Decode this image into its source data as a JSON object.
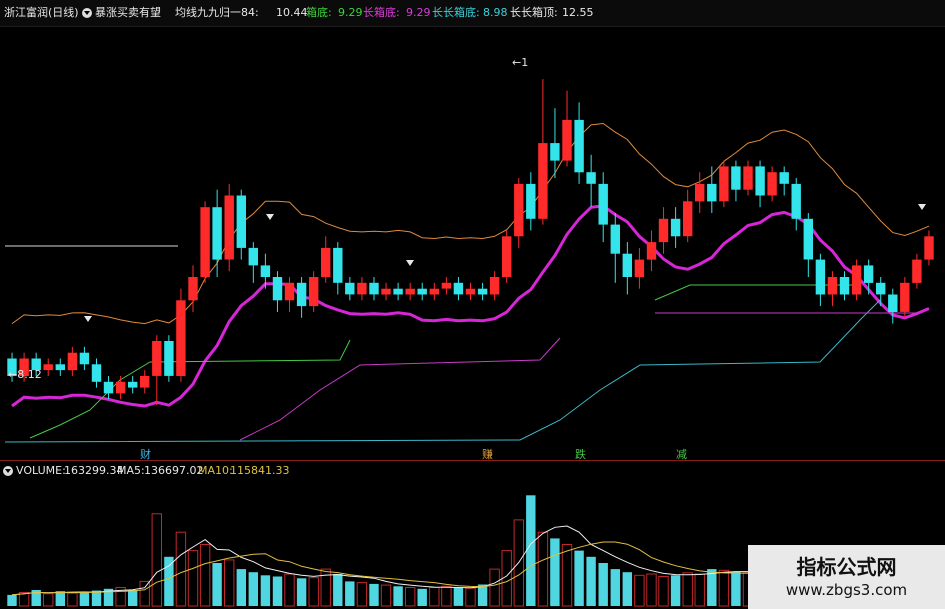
{
  "header": {
    "stock_name": "浙江富润(日线)",
    "indicator_name": "暴涨买卖有望",
    "ma_label": "均线九九归一84:",
    "ma_value": "10.44",
    "box_bottom_label": "箱底:",
    "box_bottom_value": "9.29",
    "long_box_bottom_label": "长箱底:",
    "long_box_bottom_value": "9.29",
    "longlong_box_bottom_label": "长长箱底:",
    "longlong_box_bottom_value": "8.98",
    "longlong_box_top_label": "长长箱顶:",
    "longlong_box_top_value": "12.55"
  },
  "chart_markers": {
    "high_price_label": "←1",
    "low_price_label": "←8.12",
    "signals": [
      "财",
      "赚",
      "跌",
      "减"
    ]
  },
  "volume": {
    "label": "VOLUME:",
    "value": "163299.34",
    "ma5_label": "MA5:",
    "ma5_value": "136697.02",
    "ma10_label": "MA10:",
    "ma10_value": "115841.33"
  },
  "watermark": {
    "title": "指标公式网",
    "url": "www.zbgs3.com"
  },
  "colors": {
    "up": "#ff2a2a",
    "down": "#33e4ea",
    "ma84": "#d726d7",
    "box_line": "#e08a3a",
    "volume_up": "#c0282a",
    "volume_down": "#4fd6e0",
    "ma5_line": "#f0f0f0",
    "ma10_line": "#e0c040"
  },
  "chart_data": {
    "type": "candlestick",
    "price_axis": {
      "min": 7.5,
      "max": 14.2
    },
    "candles": [
      {
        "o": 8.9,
        "c": 8.6,
        "h": 9.0,
        "l": 8.5
      },
      {
        "o": 8.6,
        "c": 8.9,
        "h": 9.0,
        "l": 8.5
      },
      {
        "o": 8.9,
        "c": 8.7,
        "h": 9.0,
        "l": 8.6
      },
      {
        "o": 8.7,
        "c": 8.8,
        "h": 8.9,
        "l": 8.6
      },
      {
        "o": 8.8,
        "c": 8.7,
        "h": 8.9,
        "l": 8.6
      },
      {
        "o": 8.7,
        "c": 9.0,
        "h": 9.1,
        "l": 8.6
      },
      {
        "o": 9.0,
        "c": 8.8,
        "h": 9.1,
        "l": 8.7
      },
      {
        "o": 8.8,
        "c": 8.5,
        "h": 8.9,
        "l": 8.4
      },
      {
        "o": 8.5,
        "c": 8.3,
        "h": 8.6,
        "l": 8.2
      },
      {
        "o": 8.3,
        "c": 8.5,
        "h": 8.6,
        "l": 8.2
      },
      {
        "o": 8.5,
        "c": 8.4,
        "h": 8.6,
        "l": 8.3
      },
      {
        "o": 8.4,
        "c": 8.6,
        "h": 8.7,
        "l": 8.3
      },
      {
        "o": 8.6,
        "c": 9.2,
        "h": 9.3,
        "l": 8.1
      },
      {
        "o": 9.2,
        "c": 8.6,
        "h": 9.3,
        "l": 8.5
      },
      {
        "o": 8.6,
        "c": 9.9,
        "h": 10.1,
        "l": 8.5
      },
      {
        "o": 9.9,
        "c": 10.3,
        "h": 10.5,
        "l": 9.7
      },
      {
        "o": 10.3,
        "c": 11.5,
        "h": 11.6,
        "l": 10.2
      },
      {
        "o": 11.5,
        "c": 10.6,
        "h": 11.8,
        "l": 10.3
      },
      {
        "o": 10.6,
        "c": 11.7,
        "h": 11.9,
        "l": 10.4
      },
      {
        "o": 11.7,
        "c": 10.8,
        "h": 11.8,
        "l": 10.6
      },
      {
        "o": 10.8,
        "c": 10.5,
        "h": 10.9,
        "l": 10.2
      },
      {
        "o": 10.5,
        "c": 10.3,
        "h": 10.7,
        "l": 10.1
      },
      {
        "o": 10.3,
        "c": 9.9,
        "h": 10.4,
        "l": 9.7
      },
      {
        "o": 9.9,
        "c": 10.2,
        "h": 10.3,
        "l": 9.7
      },
      {
        "o": 10.2,
        "c": 9.8,
        "h": 10.3,
        "l": 9.6
      },
      {
        "o": 9.8,
        "c": 10.3,
        "h": 10.4,
        "l": 9.7
      },
      {
        "o": 10.3,
        "c": 10.8,
        "h": 11.0,
        "l": 10.2
      },
      {
        "o": 10.8,
        "c": 10.2,
        "h": 10.9,
        "l": 10.0
      },
      {
        "o": 10.2,
        "c": 10.0,
        "h": 10.3,
        "l": 9.9
      },
      {
        "o": 10.0,
        "c": 10.2,
        "h": 10.3,
        "l": 9.9
      },
      {
        "o": 10.2,
        "c": 10.0,
        "h": 10.3,
        "l": 9.9
      },
      {
        "o": 10.0,
        "c": 10.1,
        "h": 10.2,
        "l": 9.9
      },
      {
        "o": 10.1,
        "c": 10.0,
        "h": 10.2,
        "l": 9.9
      },
      {
        "o": 10.0,
        "c": 10.1,
        "h": 10.2,
        "l": 9.9
      },
      {
        "o": 10.1,
        "c": 10.0,
        "h": 10.2,
        "l": 9.9
      },
      {
        "o": 10.0,
        "c": 10.1,
        "h": 10.2,
        "l": 9.9
      },
      {
        "o": 10.1,
        "c": 10.2,
        "h": 10.3,
        "l": 10.0
      },
      {
        "o": 10.2,
        "c": 10.0,
        "h": 10.3,
        "l": 9.9
      },
      {
        "o": 10.0,
        "c": 10.1,
        "h": 10.2,
        "l": 9.9
      },
      {
        "o": 10.1,
        "c": 10.0,
        "h": 10.2,
        "l": 9.9
      },
      {
        "o": 10.0,
        "c": 10.3,
        "h": 10.4,
        "l": 9.9
      },
      {
        "o": 10.3,
        "c": 11.0,
        "h": 11.1,
        "l": 10.2
      },
      {
        "o": 11.0,
        "c": 11.9,
        "h": 12.0,
        "l": 10.8
      },
      {
        "o": 11.9,
        "c": 11.3,
        "h": 12.1,
        "l": 11.1
      },
      {
        "o": 11.3,
        "c": 12.6,
        "h": 13.7,
        "l": 11.2
      },
      {
        "o": 12.6,
        "c": 12.3,
        "h": 13.2,
        "l": 12.0
      },
      {
        "o": 12.3,
        "c": 13.0,
        "h": 13.5,
        "l": 12.2
      },
      {
        "o": 13.0,
        "c": 12.1,
        "h": 13.3,
        "l": 11.9
      },
      {
        "o": 12.1,
        "c": 11.9,
        "h": 12.4,
        "l": 11.5
      },
      {
        "o": 11.9,
        "c": 11.2,
        "h": 12.1,
        "l": 10.9
      },
      {
        "o": 11.2,
        "c": 10.7,
        "h": 11.4,
        "l": 10.2
      },
      {
        "o": 10.7,
        "c": 10.3,
        "h": 10.9,
        "l": 10.0
      },
      {
        "o": 10.3,
        "c": 10.6,
        "h": 10.8,
        "l": 10.1
      },
      {
        "o": 10.6,
        "c": 10.9,
        "h": 11.1,
        "l": 10.4
      },
      {
        "o": 10.9,
        "c": 11.3,
        "h": 11.5,
        "l": 10.7
      },
      {
        "o": 11.3,
        "c": 11.0,
        "h": 11.5,
        "l": 10.8
      },
      {
        "o": 11.0,
        "c": 11.6,
        "h": 11.8,
        "l": 10.9
      },
      {
        "o": 11.6,
        "c": 11.9,
        "h": 12.1,
        "l": 11.4
      },
      {
        "o": 11.9,
        "c": 11.6,
        "h": 12.2,
        "l": 11.4
      },
      {
        "o": 11.6,
        "c": 12.2,
        "h": 12.3,
        "l": 11.5
      },
      {
        "o": 12.2,
        "c": 11.8,
        "h": 12.3,
        "l": 11.6
      },
      {
        "o": 11.8,
        "c": 12.2,
        "h": 12.3,
        "l": 11.7
      },
      {
        "o": 12.2,
        "c": 11.7,
        "h": 12.3,
        "l": 11.5
      },
      {
        "o": 11.7,
        "c": 12.1,
        "h": 12.2,
        "l": 11.6
      },
      {
        "o": 12.1,
        "c": 11.9,
        "h": 12.2,
        "l": 11.7
      },
      {
        "o": 11.9,
        "c": 11.3,
        "h": 12.0,
        "l": 11.1
      },
      {
        "o": 11.3,
        "c": 10.6,
        "h": 11.4,
        "l": 10.3
      },
      {
        "o": 10.6,
        "c": 10.0,
        "h": 10.7,
        "l": 9.8
      },
      {
        "o": 10.0,
        "c": 10.3,
        "h": 10.4,
        "l": 9.8
      },
      {
        "o": 10.3,
        "c": 10.0,
        "h": 10.4,
        "l": 9.9
      },
      {
        "o": 10.0,
        "c": 10.5,
        "h": 10.6,
        "l": 9.9
      },
      {
        "o": 10.5,
        "c": 10.2,
        "h": 10.6,
        "l": 10.0
      },
      {
        "o": 10.2,
        "c": 10.0,
        "h": 10.3,
        "l": 9.8
      },
      {
        "o": 10.0,
        "c": 9.7,
        "h": 10.1,
        "l": 9.5
      },
      {
        "o": 9.7,
        "c": 10.2,
        "h": 10.3,
        "l": 9.6
      },
      {
        "o": 10.2,
        "c": 10.6,
        "h": 10.7,
        "l": 10.1
      },
      {
        "o": 10.6,
        "c": 11.0,
        "h": 11.1,
        "l": 10.5
      }
    ],
    "volume_axis": {
      "min": 0,
      "max": 200000
    },
    "volume": [
      18000,
      22000,
      26000,
      20000,
      24000,
      21000,
      23000,
      25000,
      28000,
      30000,
      26000,
      40000,
      150000,
      80000,
      120000,
      90000,
      100000,
      70000,
      75000,
      60000,
      55000,
      50000,
      48000,
      52000,
      45000,
      46000,
      60000,
      52000,
      40000,
      38000,
      36000,
      34000,
      32000,
      30000,
      28000,
      30000,
      32000,
      30000,
      29000,
      35000,
      60000,
      90000,
      140000,
      180000,
      120000,
      110000,
      100000,
      90000,
      80000,
      70000,
      60000,
      55000,
      50000,
      52000,
      48000,
      50000,
      54000,
      52000,
      60000,
      58000,
      56000,
      54000,
      50000,
      48000,
      46000,
      52000,
      58000,
      60000,
      56000,
      54000,
      50000,
      48000,
      46000,
      50000,
      52000,
      54000,
      56000
    ]
  }
}
